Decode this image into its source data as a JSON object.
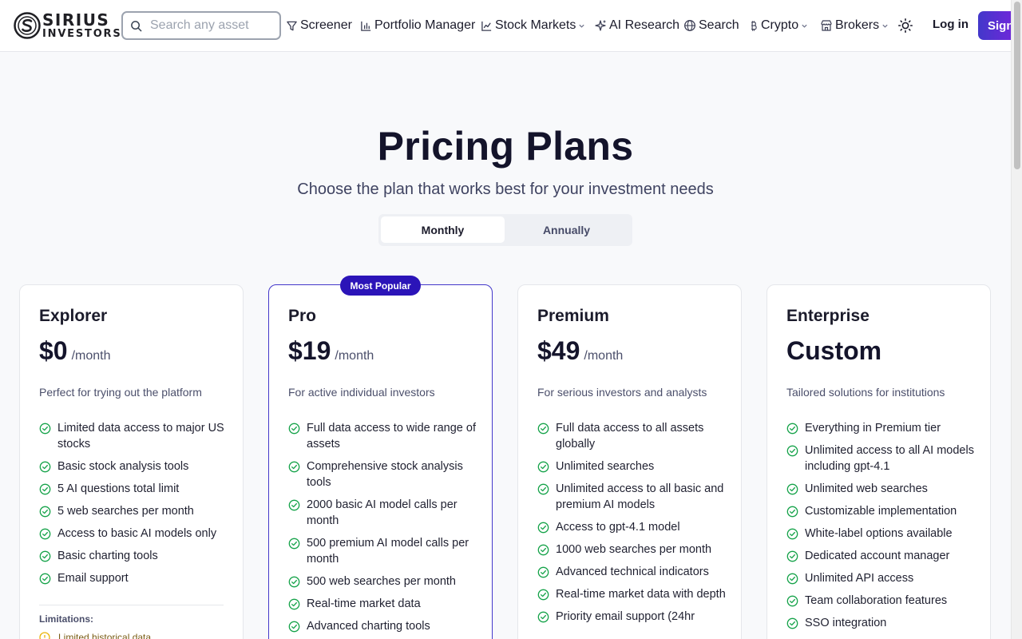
{
  "brand": {
    "line1": "SIRIUS",
    "line2": "INVESTORS"
  },
  "search": {
    "placeholder": "Search any asset"
  },
  "nav": [
    {
      "label": "Screener",
      "icon": "funnel-icon"
    },
    {
      "label": "Portfolio Manager",
      "icon": "bar-chart-icon"
    },
    {
      "label": "Stock Markets",
      "icon": "line-chart-icon",
      "dropdown": true
    },
    {
      "label": "AI Research",
      "icon": "sparkles-icon"
    },
    {
      "label": "Search",
      "icon": "globe-icon"
    },
    {
      "label": "Crypto",
      "icon": "bitcoin-icon",
      "dropdown": true
    },
    {
      "label": "Brokers",
      "icon": "store-icon",
      "dropdown": true
    }
  ],
  "header": {
    "theme_icon": "sun-icon",
    "login": "Log in",
    "signup": "Sign"
  },
  "hero": {
    "title": "Pricing Plans",
    "subtitle": "Choose the plan that works best for your investment needs"
  },
  "billing_toggle": {
    "monthly": "Monthly",
    "annually": "Annually",
    "selected": "Monthly"
  },
  "plans": [
    {
      "name": "Explorer",
      "price": "$0",
      "period": "/month",
      "description": "Perfect for trying out the platform",
      "features": [
        "Limited data access to major US stocks",
        "Basic stock analysis tools",
        "5 AI questions total limit",
        "5 web searches per month",
        "Access to basic AI models only",
        "Basic charting tools",
        "Email support"
      ],
      "limitations_title": "Limitations:",
      "limitations": [
        "Limited historical data"
      ]
    },
    {
      "name": "Pro",
      "badge": "Most Popular",
      "price": "$19",
      "period": "/month",
      "description": "For active individual investors",
      "features": [
        "Full data access to wide range of assets",
        "Comprehensive stock analysis tools",
        "2000 basic AI model calls per month",
        "500 premium AI model calls per month",
        "500 web searches per month",
        "Real-time market data",
        "Advanced charting tools"
      ]
    },
    {
      "name": "Premium",
      "price": "$49",
      "period": "/month",
      "description": "For serious investors and analysts",
      "features": [
        "Full data access to all assets globally",
        "Unlimited searches",
        "Unlimited access to all basic and premium AI models",
        "Access to gpt-4.1 model",
        "1000 web searches per month",
        "Advanced technical indicators",
        "Real-time market data with depth",
        "Priority email support (24hr"
      ]
    },
    {
      "name": "Enterprise",
      "price": "Custom",
      "period": "",
      "description": "Tailored solutions for institutions",
      "features": [
        "Everything in Premium tier",
        "Unlimited access to all AI models including gpt-4.1",
        "Unlimited web searches",
        "Customizable implementation",
        "White-label options available",
        "Dedicated account manager",
        "Unlimited API access",
        "Team collaboration features",
        "SSO integration"
      ]
    }
  ],
  "colors": {
    "accent": "#4338ca",
    "badge": "#2b14b8",
    "check": "#16a34a",
    "warning": "#eab308"
  }
}
